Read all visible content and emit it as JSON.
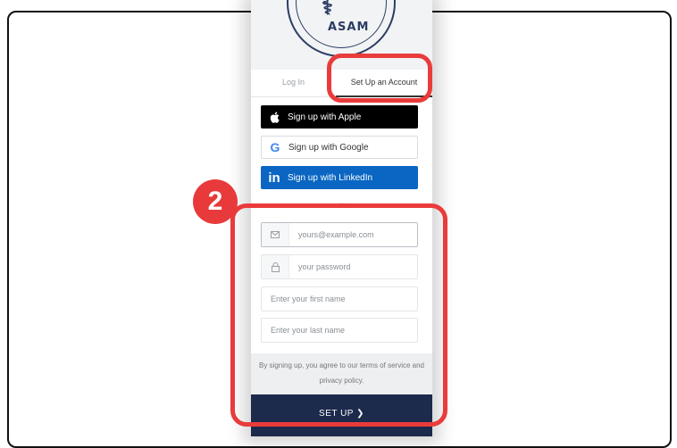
{
  "logo": {
    "text": "ASAM",
    "caduceus": "⚕"
  },
  "tabs": {
    "login": "Log In",
    "signup": "Set Up an Account"
  },
  "sso": {
    "apple": "Sign up with Apple",
    "google": "Sign up with Google",
    "linkedin": "Sign up with LinkedIn"
  },
  "divider": "or",
  "fields": {
    "email_placeholder": "yours@example.com",
    "password_placeholder": "your password",
    "first_name_placeholder": "Enter your first name",
    "last_name_placeholder": "Enter your last name"
  },
  "terms": "By signing up, you agree to our terms of service and privacy policy.",
  "submit_label": "SET UP ❯",
  "annotation": {
    "badge": "2"
  },
  "colors": {
    "highlight": "#ea3b3b",
    "primary_button": "#1c2a4b",
    "linkedin": "#0a66c2",
    "apple": "#000000"
  }
}
